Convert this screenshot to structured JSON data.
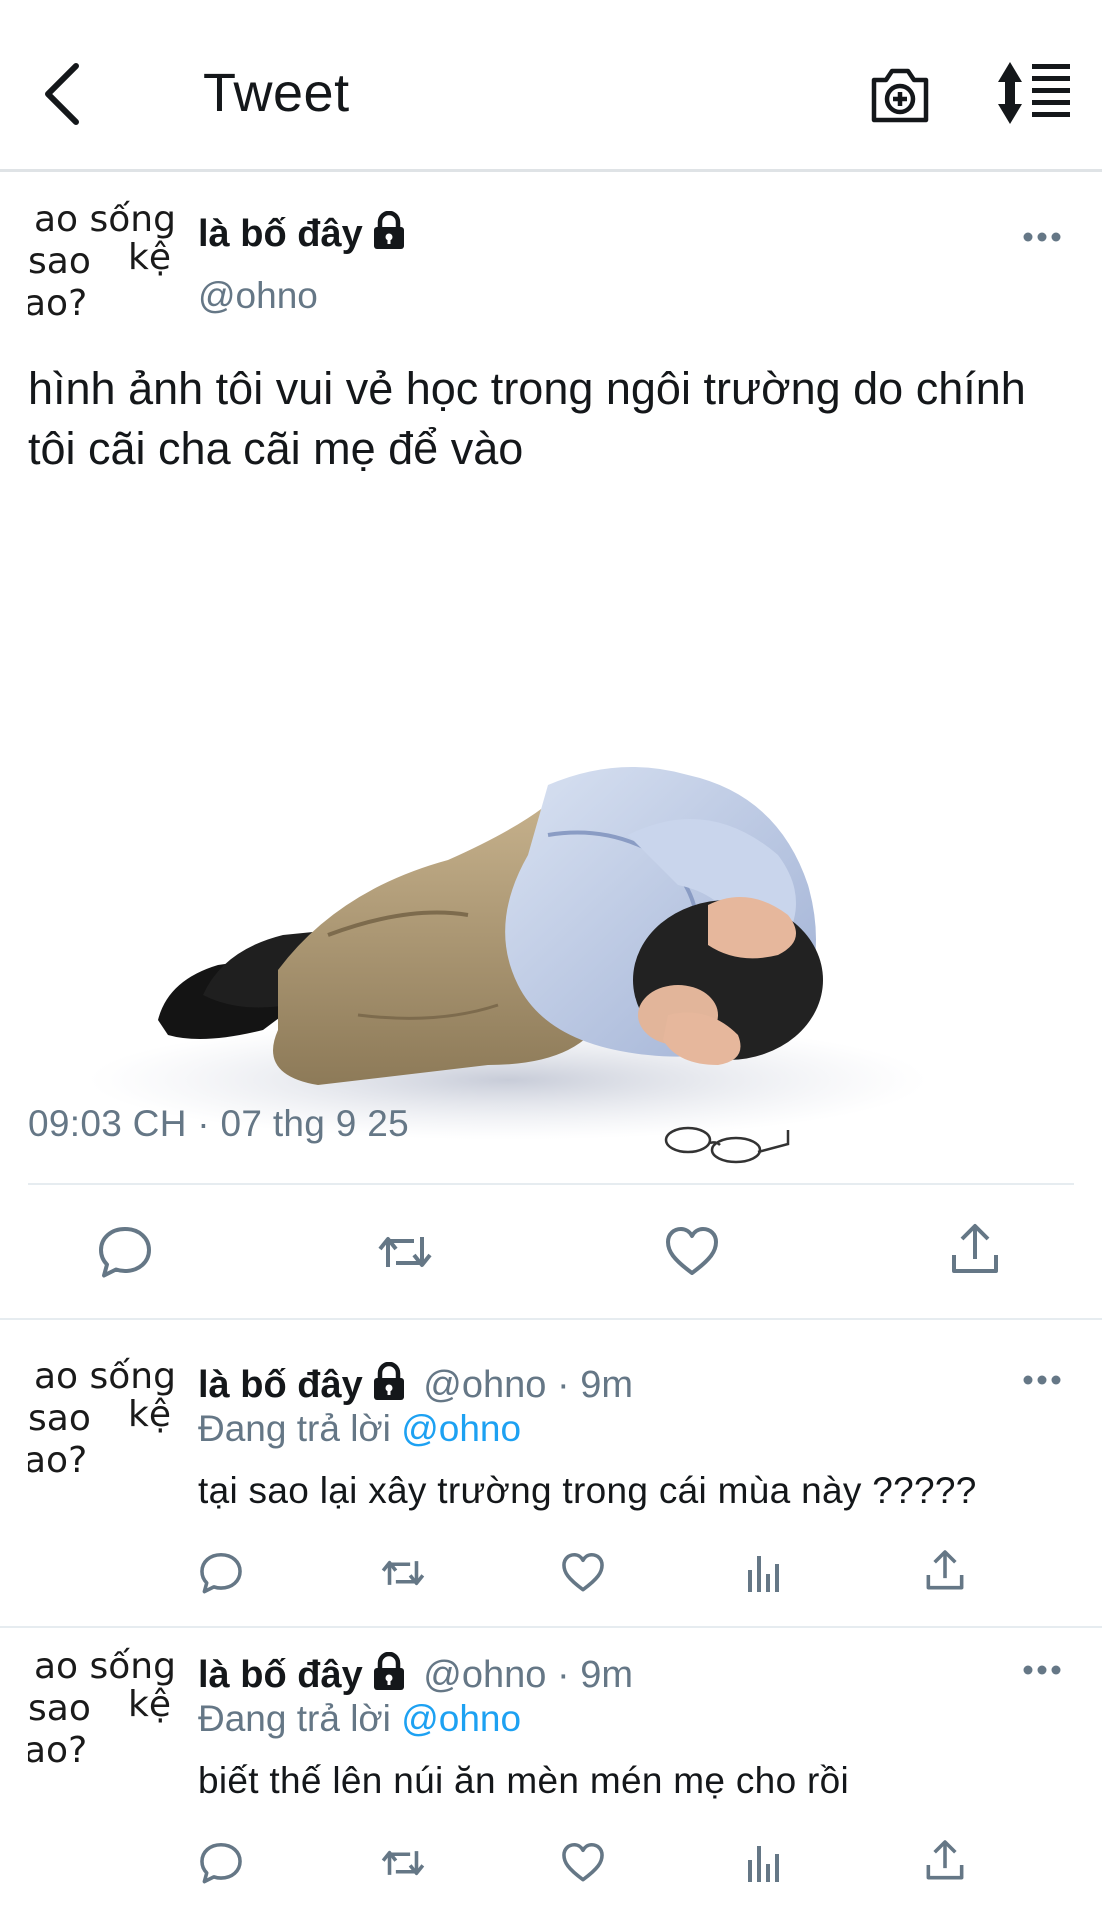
{
  "header": {
    "title": "Tweet",
    "icons": [
      "back-chevron-icon",
      "camera-plus-icon",
      "sort-list-icon"
    ]
  },
  "avatar_text": {
    "line1": "ao sống",
    "line2": "sao",
    "line3": "kệ",
    "line4": "ao?"
  },
  "main_tweet": {
    "name": "là bố đây",
    "handle": "@ohno",
    "text": "hình ảnh tôi vui vẻ học trong ngôi trường do chính tôi cãi cha cãi mẹ để vào",
    "timestamp": "09:03 CH · 07 thg 9 25",
    "actions": [
      "reply-icon",
      "retweet-icon",
      "like-icon",
      "share-icon"
    ]
  },
  "replies": [
    {
      "name": "là bố đây",
      "handle": "@ohno",
      "separator": "·",
      "time": "9m",
      "replying_prefix": "Đang trả lời",
      "replying_to": "@ohno",
      "text": "tại sao lại xây trường trong cái mùa này ?????"
    },
    {
      "name": "là bố đây",
      "handle": "@ohno",
      "separator": "·",
      "time": "9m",
      "replying_prefix": "Đang trả lời",
      "replying_to": "@ohno",
      "text": "biết thế lên núi ăn mèn mén mẹ cho rồi"
    }
  ],
  "colors": {
    "text_primary": "#14171a",
    "text_secondary": "#657786",
    "link": "#1da1f2",
    "divider": "#e6ecf0"
  }
}
